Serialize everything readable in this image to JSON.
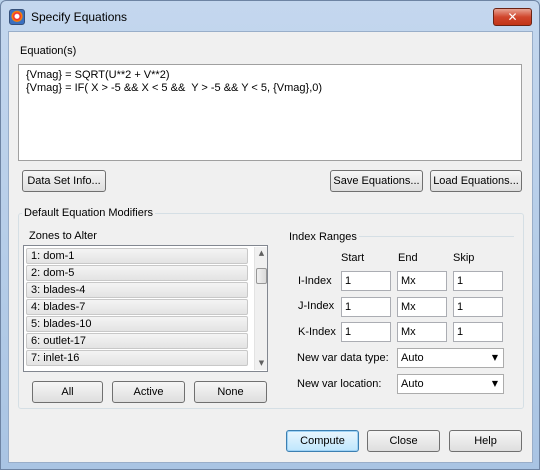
{
  "window": {
    "title": "Specify Equations",
    "close_glyph": "✕"
  },
  "equations": {
    "label": "Equation(s)",
    "lines": [
      "{Vmag} = SQRT(U**2 + V**2)",
      "{Vmag} = IF( X > -5 && X < 5 &&  Y > -5 && Y < 5, {Vmag},0)"
    ]
  },
  "buttons": {
    "data_set_info": "Data Set Info...",
    "save_equations": "Save Equations...",
    "load_equations": "Load Equations...",
    "all": "All",
    "active": "Active",
    "none": "None",
    "compute": "Compute",
    "close": "Close",
    "help": "Help"
  },
  "modifiers": {
    "title": "Default Equation Modifiers",
    "zones_label": "Zones to Alter",
    "zones": [
      "1: dom-1",
      "2: dom-5",
      "3: blades-4",
      "4: blades-7",
      "5: blades-10",
      "6: outlet-17",
      "7: inlet-16"
    ]
  },
  "index_ranges": {
    "title": "Index Ranges",
    "col_start": "Start",
    "col_end": "End",
    "col_skip": "Skip",
    "rows": [
      {
        "label": "I-Index",
        "start": "1",
        "end": "Mx",
        "skip": "1"
      },
      {
        "label": "J-Index",
        "start": "1",
        "end": "Mx",
        "skip": "1"
      },
      {
        "label": "K-Index",
        "start": "1",
        "end": "Mx",
        "skip": "1"
      }
    ],
    "data_type_label": "New var data type:",
    "data_type_value": "Auto",
    "location_label": "New var location:",
    "location_value": "Auto"
  },
  "icons": {
    "dropdown": "▼",
    "scroll_up": "▲",
    "scroll_down": "▼",
    "app": "tecplot-icon"
  }
}
